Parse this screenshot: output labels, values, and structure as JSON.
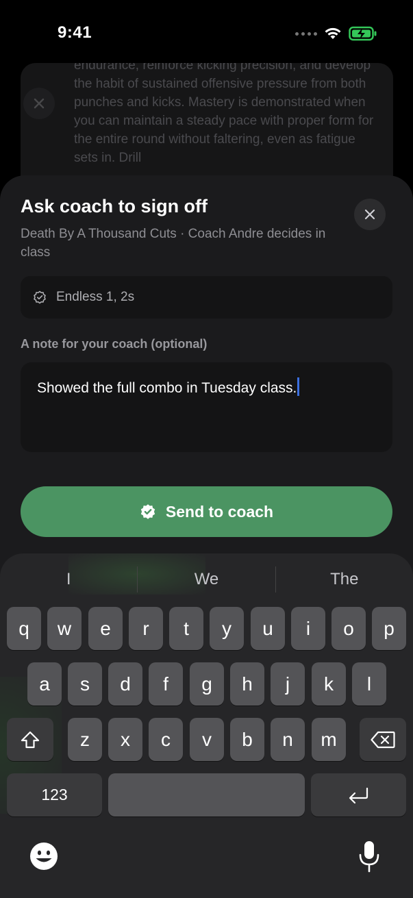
{
  "status_bar": {
    "time": "9:41"
  },
  "background_sheet": {
    "text": "endurance, reinforce kicking precision, and develop the habit of sustained offensive pressure from both punches and kicks. Mastery is demonstrated when you can maintain a steady pace with proper form for the entire round without faltering, even as fatigue sets in. Drill"
  },
  "sheet": {
    "title": "Ask coach to sign off",
    "subtitle": "Death By A Thousand Cuts · Coach Andre decides in class",
    "chip_label": "Endless 1, 2s",
    "note_label": "A note for your coach (optional)",
    "note_value": "Showed the full combo in Tuesday class.",
    "send_label": "Send to coach"
  },
  "keyboard": {
    "suggestions": [
      "I",
      "We",
      "The"
    ],
    "row1": [
      "q",
      "w",
      "e",
      "r",
      "t",
      "y",
      "u",
      "i",
      "o",
      "p"
    ],
    "row2": [
      "a",
      "s",
      "d",
      "f",
      "g",
      "h",
      "j",
      "k",
      "l"
    ],
    "row3": [
      "z",
      "x",
      "c",
      "v",
      "b",
      "n",
      "m"
    ],
    "numbers_label": "123"
  },
  "colors": {
    "accent": "#4b9462",
    "caret": "#3b6fe0",
    "sheet_bg": "#1b1b1d",
    "battery": "#34c759"
  }
}
